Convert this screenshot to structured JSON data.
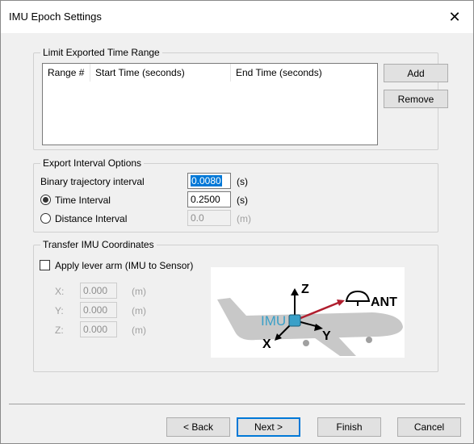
{
  "window": {
    "title": "IMU Epoch Settings",
    "close_glyph": "✕"
  },
  "time_range": {
    "group_label": "Limit Exported Time Range",
    "columns": [
      "Range #",
      "Start Time (seconds)",
      "End Time (seconds)"
    ],
    "add_label": "Add",
    "remove_label": "Remove"
  },
  "export_interval": {
    "group_label": "Export Interval Options",
    "binary_label": "Binary trajectory interval",
    "binary_value": "0.0080",
    "binary_unit": "(s)",
    "time_label": "Time Interval",
    "time_value": "0.2500",
    "time_unit": "(s)",
    "time_selected": true,
    "distance_label": "Distance Interval",
    "distance_value": "0.0",
    "distance_unit": "(m)"
  },
  "transfer": {
    "group_label": "Transfer IMU Coordinates",
    "lever_label": "Apply lever arm (IMU to Sensor)",
    "lever_checked": false,
    "x_label": "X:",
    "x_value": "0.000",
    "x_unit": "(m)",
    "y_label": "Y:",
    "y_value": "0.000",
    "y_unit": "(m)",
    "z_label": "Z:",
    "z_value": "0.000",
    "z_unit": "(m)",
    "diagram": {
      "imu": "IMU",
      "ant": "ANT",
      "z": "Z",
      "x": "X",
      "y": "Y",
      "imu_color": "#3aa0c8",
      "arrow_color": "#b01e2e"
    }
  },
  "footer": {
    "back_label": "< Back",
    "next_label": "Next >",
    "finish_label": "Finish",
    "cancel_label": "Cancel"
  }
}
